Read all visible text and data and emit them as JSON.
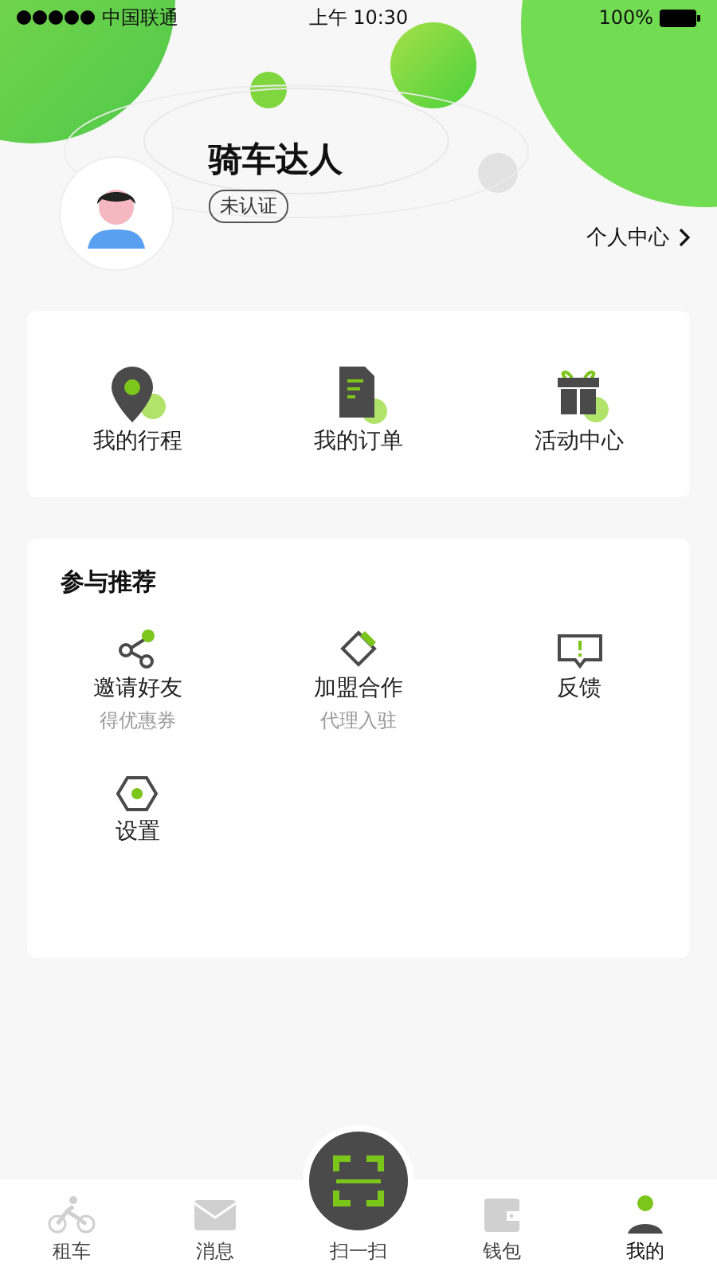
{
  "status_bar": {
    "carrier": "中国联通",
    "time": "上午 10:30",
    "battery": "100%"
  },
  "profile": {
    "name": "骑车达人",
    "badge": "未认证",
    "link": "个人中心"
  },
  "shortcuts": [
    {
      "kind": "pin",
      "label": "我的行程"
    },
    {
      "kind": "doc",
      "label": "我的订单"
    },
    {
      "kind": "gift",
      "label": "活动中心"
    }
  ],
  "section": {
    "title": "参与推荐",
    "items": [
      {
        "kind": "share",
        "label": "邀请好友",
        "sublabel": "得优惠券"
      },
      {
        "kind": "diamond",
        "label": "加盟合作",
        "sublabel": "代理入驻"
      },
      {
        "kind": "feedback",
        "label": "反馈"
      },
      {
        "kind": "hex",
        "label": "设置"
      }
    ]
  },
  "tab_bar": [
    {
      "kind": "bike",
      "label": "租车",
      "selected": false
    },
    {
      "kind": "mail",
      "label": "消息",
      "selected": false
    },
    {
      "kind": "scan",
      "label": "扫一扫",
      "selected": false
    },
    {
      "kind": "wallet",
      "label": "钱包",
      "selected": false
    },
    {
      "kind": "person",
      "label": "我的",
      "selected": true
    }
  ]
}
